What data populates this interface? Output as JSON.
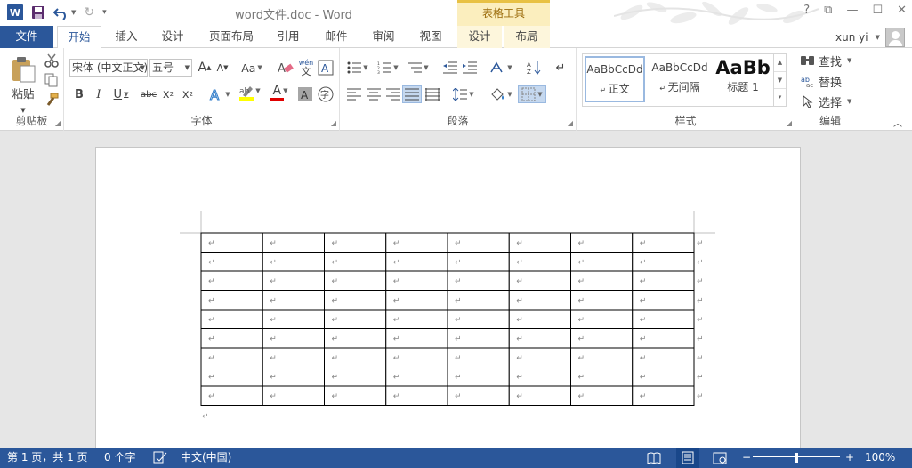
{
  "title_bar": {
    "document_title": "word文件.doc - Word",
    "contextual_group": "表格工具",
    "window_controls": [
      "?",
      "⧉",
      "—",
      "☐",
      "✕"
    ]
  },
  "ribbon_tabs": [
    {
      "label": "文件"
    },
    {
      "label": "开始"
    },
    {
      "label": "插入"
    },
    {
      "label": "设计"
    },
    {
      "label": "页面布局"
    },
    {
      "label": "引用"
    },
    {
      "label": "邮件"
    },
    {
      "label": "审阅"
    },
    {
      "label": "视图"
    },
    {
      "label": "设计"
    },
    {
      "label": "布局"
    }
  ],
  "user": {
    "name": "xun yi"
  },
  "clipboard": {
    "paste_label": "粘贴",
    "group_label": "剪贴板"
  },
  "font": {
    "name_value": "宋体 (中文正文)",
    "size_value": "五号",
    "change_case_label": "Aa",
    "phonetic_top": "wén",
    "phonetic_bottom": "文",
    "group_label": "字体"
  },
  "paragraph": {
    "group_label": "段落"
  },
  "styles": {
    "items": [
      {
        "sample": "AaBbCcDd",
        "name": "正文"
      },
      {
        "sample": "AaBbCcDd",
        "name": "无间隔"
      },
      {
        "sample": "AaBb",
        "name": "标题 1"
      }
    ],
    "group_label": "样式"
  },
  "editing": {
    "find_label": "查找",
    "replace_label": "替换",
    "select_label": "选择",
    "group_label": "编辑"
  },
  "document": {
    "table": {
      "rows": 9,
      "cols": 8,
      "cell_mark": "↵"
    }
  },
  "status_bar": {
    "page_info": "第 1 页，共 1 页",
    "word_count": "0 个字",
    "language": "中文(中国)",
    "zoom_minus": "−",
    "zoom_plus": "+",
    "zoom_level": "100%"
  },
  "colors": {
    "accent": "#2b579a",
    "contextual_tab_bg": "#fbeebe",
    "contextual_tab_border": "#e8c144",
    "highlight": "#ffff00",
    "font_color": "#e00000"
  }
}
